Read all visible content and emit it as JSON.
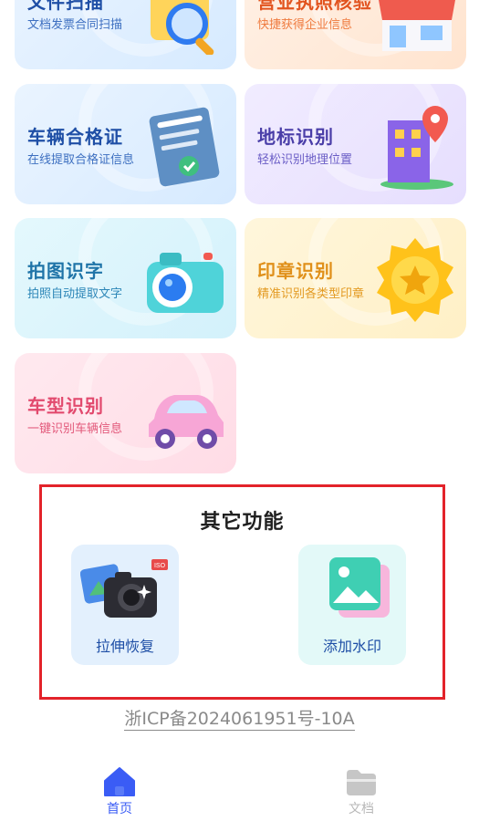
{
  "cards": [
    {
      "title": "文件扫描",
      "subtitle": "文档发票合同扫描"
    },
    {
      "title": "营业执照核验",
      "subtitle": "快捷获得企业信息"
    },
    {
      "title": "车辆合格证",
      "subtitle": "在线提取合格证信息"
    },
    {
      "title": "地标识别",
      "subtitle": "轻松识别地理位置"
    },
    {
      "title": "拍图识字",
      "subtitle": "拍照自动提取文字"
    },
    {
      "title": "印章识别",
      "subtitle": "精准识别各类型印章"
    },
    {
      "title": "车型识别",
      "subtitle": "一键识别车辆信息"
    }
  ],
  "other": {
    "heading": "其它功能",
    "tools": [
      {
        "label": "拉伸恢复",
        "badge": "ISO"
      },
      {
        "label": "添加水印"
      }
    ]
  },
  "icp": "浙ICP备2024061951号-10A",
  "tabbar": {
    "tabs": [
      {
        "label": "首页",
        "icon": "home-icon",
        "active": true
      },
      {
        "label": "文档",
        "icon": "folder-icon",
        "active": false
      }
    ]
  },
  "colors": {
    "accent": "#3a5cf5",
    "highlight_border": "#e3232a",
    "inactive_tab": "#b8b8b8"
  }
}
